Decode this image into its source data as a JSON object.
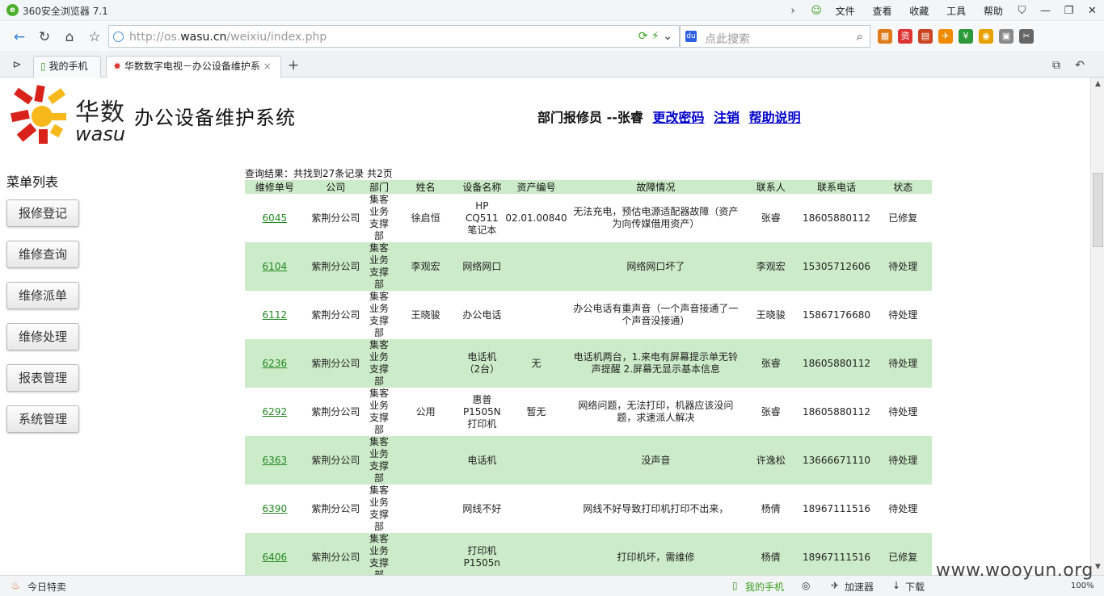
{
  "browser": {
    "title": "360安全浏览器 7.1",
    "menu": [
      "文件",
      "查看",
      "收藏",
      "工具",
      "帮助"
    ],
    "url_gray": "http://os.",
    "url_domain": "wasu.cn",
    "url_path": "/weixiu/index.php",
    "search_placeholder": "点此搜索",
    "tabs": [
      "我的手机",
      "华数数字电视－办公设备维护系"
    ],
    "status_left": "今日特卖",
    "status_phone": "我的手机",
    "status_accel": "加速器",
    "status_download": "下载",
    "zoom": "100%"
  },
  "header": {
    "brand_cn": "华数",
    "brand_en": "wasu",
    "system_title": "办公设备维护系统",
    "user_label": "部门报修员 --张睿",
    "links": [
      "更改密码",
      "注销",
      "帮助说明"
    ]
  },
  "sidebar": {
    "title": "菜单列表",
    "buttons": [
      "报修登记",
      "维修查询",
      "维修派单",
      "维修处理",
      "报表管理",
      "系统管理"
    ]
  },
  "result_text": "查询结果：共找到27条记录 共2页",
  "table": {
    "headers": [
      "维修单号",
      "公司",
      "部门",
      "姓名",
      "设备名称",
      "资产编号",
      "故障情况",
      "联系人",
      "联系电话",
      "状态"
    ],
    "rows": [
      [
        "6045",
        "紫荆分公司",
        "集客业务支撑部",
        "徐启恒",
        "HP CQ511笔记本",
        "02.01.00840",
        "无法充电，预估电源适配器故障（资产为向传媒借用资产）",
        "张睿",
        "18605880112",
        "已修复"
      ],
      [
        "6104",
        "紫荆分公司",
        "集客业务支撑部",
        "李观宏",
        "网络网口",
        "",
        "网络网口坏了",
        "李观宏",
        "15305712606",
        "待处理"
      ],
      [
        "6112",
        "紫荆分公司",
        "集客业务支撑部",
        "王晓骏",
        "办公电话",
        "",
        "办公电话有重声音（一个声音接通了一个声音没接通）",
        "王晓骏",
        "15867176680",
        "待处理"
      ],
      [
        "6236",
        "紫荆分公司",
        "集客业务支撑部",
        "",
        "电话机（2台）",
        "无",
        "电话机两台，1.来电有屏幕提示单无铃声提醒 2.屏幕无显示基本信息",
        "张睿",
        "18605880112",
        "待处理"
      ],
      [
        "6292",
        "紫荆分公司",
        "集客业务支撑部",
        "公用",
        "惠普P1505N打印机",
        "暂无",
        "网络问题，无法打印，机器应该没问题，求速派人解决",
        "张睿",
        "18605880112",
        "待处理"
      ],
      [
        "6363",
        "紫荆分公司",
        "集客业务支撑部",
        "",
        "电话机",
        "",
        "没声音",
        "许逸松",
        "13666671110",
        "待处理"
      ],
      [
        "6390",
        "紫荆分公司",
        "集客业务支撑部",
        "",
        "网线不好",
        "",
        "网线不好导致打印机打印不出来，",
        "杨倩",
        "18967111516",
        "待处理"
      ],
      [
        "6406",
        "紫荆分公司",
        "集客业务支撑部",
        "",
        "打印机P1505n",
        "",
        "打印机坏，需维修",
        "杨倩",
        "18967111516",
        "已修复"
      ]
    ]
  },
  "watermark": "www.wooyun.org"
}
